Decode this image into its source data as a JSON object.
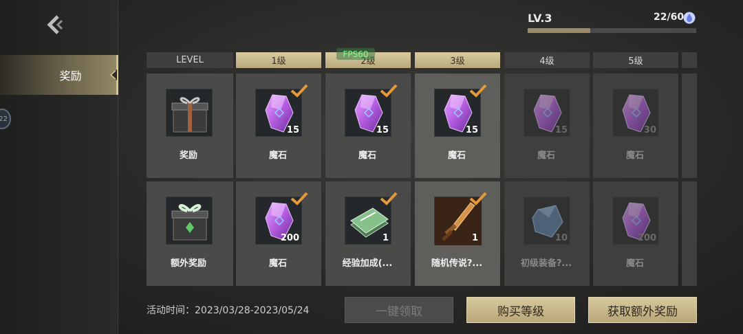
{
  "sidebar": {
    "tab_label": "奖励",
    "badge": "22"
  },
  "header": {
    "level": "LV.3",
    "exp_text": "22/60",
    "exp_progress": 0.37
  },
  "fps": "FPS60",
  "columns": [
    {
      "label": "LEVEL",
      "style": "plain"
    },
    {
      "label": "1级",
      "style": "gold"
    },
    {
      "label": "2级",
      "style": "gold"
    },
    {
      "label": "3级",
      "style": "gold"
    },
    {
      "label": "4级",
      "style": "plain"
    },
    {
      "label": "5级",
      "style": "plain"
    }
  ],
  "rows": [
    [
      {
        "name": "奖励",
        "qty": "",
        "icon": "gift-box-icon",
        "claimed": false,
        "state": "normal"
      },
      {
        "name": "魔石",
        "qty": "15",
        "icon": "magic-stone-icon",
        "claimed": true,
        "state": "normal"
      },
      {
        "name": "魔石",
        "qty": "15",
        "icon": "magic-stone-icon",
        "claimed": true,
        "state": "normal"
      },
      {
        "name": "魔石",
        "qty": "15",
        "icon": "magic-stone-icon",
        "claimed": true,
        "state": "highlight"
      },
      {
        "name": "魔石",
        "qty": "15",
        "icon": "magic-stone-icon",
        "claimed": false,
        "state": "dim"
      },
      {
        "name": "魔石",
        "qty": "30",
        "icon": "magic-stone-icon",
        "claimed": false,
        "state": "dim"
      }
    ],
    [
      {
        "name": "额外奖励",
        "qty": "",
        "icon": "green-gift-box-icon",
        "claimed": false,
        "state": "normal"
      },
      {
        "name": "魔石",
        "qty": "200",
        "icon": "magic-stone-icon",
        "claimed": true,
        "state": "normal"
      },
      {
        "name": "经验加成(...",
        "qty": "1",
        "icon": "exp-card-icon",
        "claimed": true,
        "state": "normal"
      },
      {
        "name": "随机传说?...",
        "qty": "1",
        "icon": "legendary-dagger-icon",
        "claimed": true,
        "state": "highlight"
      },
      {
        "name": "初级装备?...",
        "qty": "10",
        "icon": "blue-ore-icon",
        "claimed": false,
        "state": "dim"
      },
      {
        "name": "魔石",
        "qty": "200",
        "icon": "magic-stone-icon",
        "claimed": false,
        "state": "dim"
      }
    ]
  ],
  "footer": {
    "time_label": "活动时间：2023/03/28-2023/05/24",
    "claim_all": "一键领取",
    "buy_level": "购买等级",
    "extra_reward": "获取额外奖励"
  },
  "colors": {
    "gold": "#d6c690",
    "check": "#e49a3a",
    "stone": "#b35ce0"
  }
}
